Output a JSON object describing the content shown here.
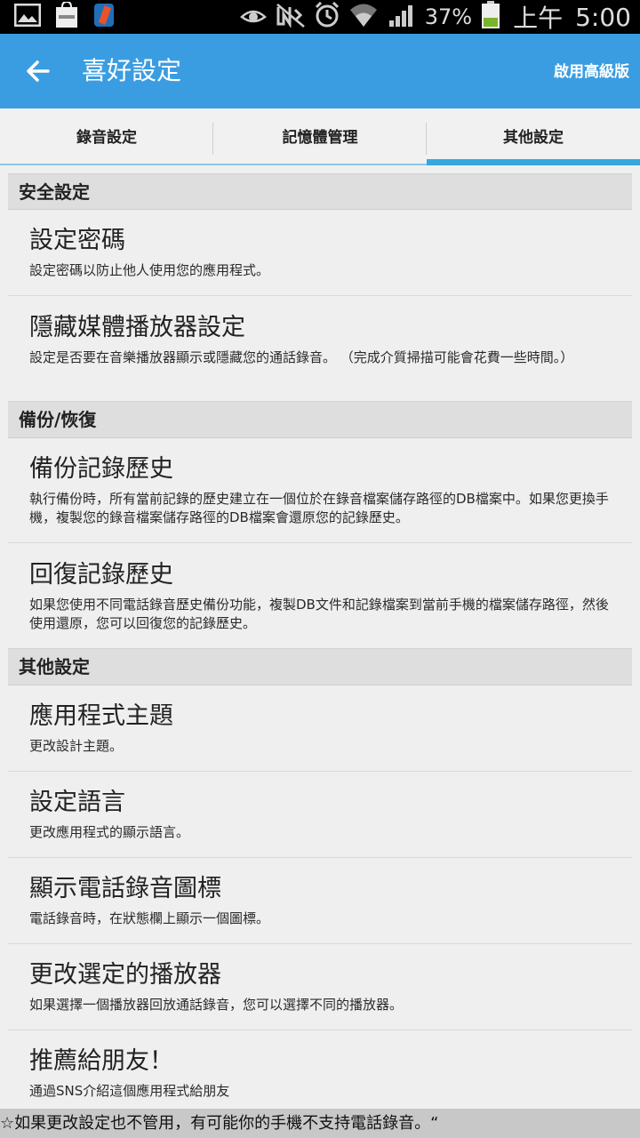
{
  "status_bar": {
    "battery": "37%",
    "ampm": "上午",
    "time": "5:00",
    "icons": [
      "gallery-icon",
      "galaxy-bag-icon",
      "app-icon",
      "eye-icon",
      "mute-icon",
      "alarm-icon",
      "wifi-icon",
      "signal-icon",
      "battery-icon"
    ]
  },
  "appbar": {
    "title": "喜好設定",
    "upgrade": "啟用高級版",
    "color": "#3b9de1"
  },
  "tabs": [
    {
      "label": "錄音設定",
      "active": false
    },
    {
      "label": "記憶體管理",
      "active": false
    },
    {
      "label": "其他設定",
      "active": true
    }
  ],
  "sections": {
    "security": {
      "header": "安全設定",
      "items": [
        {
          "title": "設定密碼",
          "summary": "設定密碼以防止他人使用您的應用程式。"
        },
        {
          "title": "隱藏媒體播放器設定",
          "summary": "設定是否要在音樂播放器顯示或隱藏您的通話錄音。 （完成介質掃描可能會花費一些時間。）"
        }
      ]
    },
    "backup": {
      "header": "備份/恢復",
      "items": [
        {
          "title": "備份記錄歷史",
          "summary": "執行備份時，所有當前記錄的歷史建立在一個位於在錄音檔案儲存路徑的DB檔案中。如果您更換手機，複製您的錄音檔案儲存路徑的DB檔案會還原您的記錄歷史。"
        },
        {
          "title": "回復記錄歷史",
          "summary": "如果您使用不同電話錄音歷史備份功能，複製DB文件和記錄檔案到當前手機的檔案儲存路徑，然後使用還原，您可以回復您的記錄歷史。"
        }
      ]
    },
    "other": {
      "header": "其他設定",
      "items": [
        {
          "title": "應用程式主題",
          "summary": "更改設計主題。"
        },
        {
          "title": "設定語言",
          "summary": "更改應用程式的顯示語言。"
        },
        {
          "title": "顯示電話錄音圖標",
          "summary": "電話錄音時，在狀態欄上顯示一個圖標。"
        },
        {
          "title": "更改選定的播放器",
          "summary": "如果選擇一個播放器回放通話錄音，您可以選擇不同的播放器。"
        },
        {
          "title": "推薦給朋友！",
          "summary": "通過SNS介紹這個應用程式給朋友"
        }
      ]
    }
  },
  "footer": {
    "text": "☆如果更改設定也不管用，有可能你的手機不支持電話錄音。“"
  }
}
